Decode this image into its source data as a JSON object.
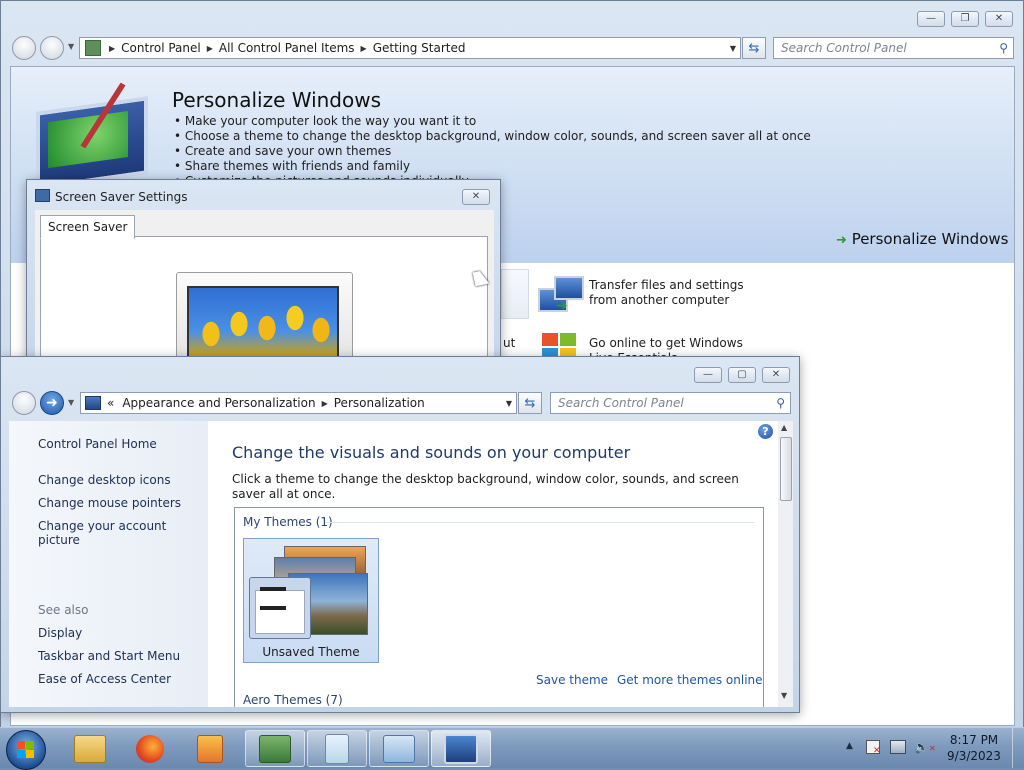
{
  "getting_started": {
    "breadcrumb": [
      "Control Panel",
      "All Control Panel Items",
      "Getting Started"
    ],
    "search_placeholder": "Search Control Panel",
    "heading": "Personalize Windows",
    "bullets": [
      "Make your computer look the way you want it to",
      "Choose a theme to change the desktop background, window color, sounds, and screen saver all at once",
      "Create and save your own themes",
      "Share themes with friends and family",
      "Customize the pictures and sounds individually"
    ],
    "action_link": "Personalize Windows",
    "tasks": [
      {
        "label": "Transfer files and settings from another computer",
        "icon": "transfer-icon"
      },
      {
        "label": "Go online to get Windows Live Essentials",
        "icon": "windows-live-icon"
      }
    ],
    "partial_text": "ut"
  },
  "screen_saver": {
    "title": "Screen Saver Settings",
    "tab": "Screen Saver"
  },
  "personalization": {
    "breadcrumb_prefix": "«",
    "breadcrumb": [
      "Appearance and Personalization",
      "Personalization"
    ],
    "search_placeholder": "Search Control Panel",
    "sidebar": {
      "home": "Control Panel Home",
      "links": [
        "Change desktop icons",
        "Change mouse pointers",
        "Change your account picture"
      ],
      "see_also_label": "See also",
      "see_also": [
        "Display",
        "Taskbar and Start Menu",
        "Ease of Access Center"
      ]
    },
    "heading": "Change the visuals and sounds on your computer",
    "description": "Click a theme to change the desktop background, window color, sounds, and screen saver all at once.",
    "my_themes_label": "My Themes (1)",
    "theme_name": "Unsaved Theme",
    "save_theme": "Save theme",
    "more_themes": "Get more themes online",
    "aero_label": "Aero Themes (7)"
  },
  "taskbar": {
    "apps": [
      "start-orb",
      "file-explorer-icon",
      "firefox-icon",
      "media-player-icon",
      "control-panel-icon",
      "notepad-icon",
      "remote-desktop-icon",
      "personalization-icon"
    ],
    "time": "8:17 PM",
    "date": "9/3/2023"
  }
}
